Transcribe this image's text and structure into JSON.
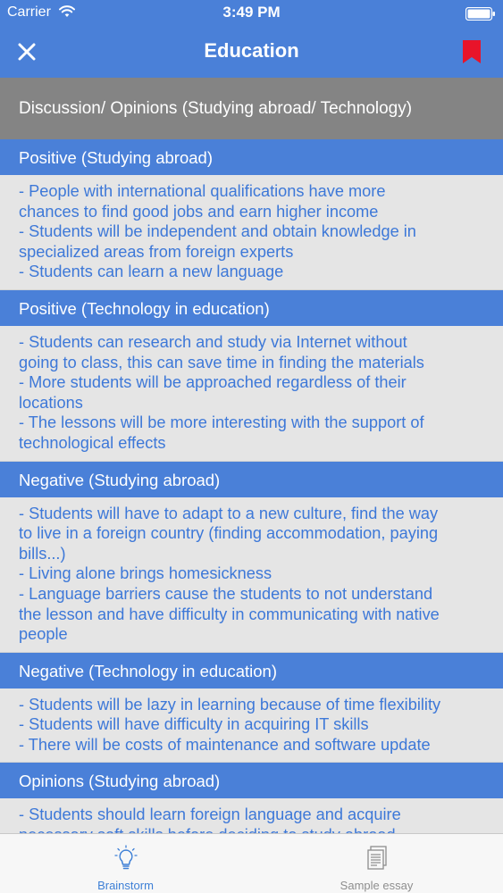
{
  "status_bar": {
    "carrier": "Carrier",
    "time": "3:49 PM"
  },
  "nav": {
    "title": "Education",
    "close_icon": "close-icon",
    "bookmark_icon": "bookmark-icon"
  },
  "topic": "Discussion/ Opinions (Studying abroad/ Technology)",
  "sections": [
    {
      "title": "Positive (Studying abroad)",
      "lines": [
        "- People with international qualifications have more",
        "chances to find good jobs and earn higher income",
        "- Students will be independent and obtain knowledge in",
        "specialized areas from foreign experts",
        "- Students can learn a new language"
      ]
    },
    {
      "title": "Positive (Technology in education)",
      "lines": [
        "- Students can research and study via Internet without",
        "going to class, this can save time in finding the materials",
        "- More students will be approached regardless of their",
        "locations",
        "- The lessons will be more interesting with the support of",
        "technological effects"
      ]
    },
    {
      "title": "Negative (Studying abroad)",
      "lines": [
        "- Students will have to adapt to a new culture, find the way",
        "to live in a foreign country (finding accommodation, paying",
        "bills...)",
        "- Living alone brings homesickness",
        "- Language barriers cause the students to not understand",
        "the lesson and have difficulty in communicating with native",
        "people"
      ]
    },
    {
      "title": "Negative (Technology in education)",
      "lines": [
        "- Students will be lazy in learning because of time flexibility",
        "- Students will have difficulty in acquiring IT skills",
        "- There will be costs of maintenance and software update"
      ]
    },
    {
      "title": "Opinions (Studying abroad)",
      "lines": [
        "- Students should learn foreign language and acquire",
        "necessary soft skills before deciding to study abroad"
      ]
    }
  ],
  "tabs": [
    {
      "label": "Brainstorm",
      "icon": "lightbulb-icon",
      "active": true
    },
    {
      "label": "Sample essay",
      "icon": "document-stack-icon",
      "active": false
    }
  ],
  "colors": {
    "primary": "#4a80d8",
    "topic_bg": "#848484",
    "body_text": "#3d78d8",
    "body_bg": "#e5e5e5",
    "bookmark": "#e8142a",
    "tab_active": "#3d7fd6",
    "tab_inactive": "#8e8e8e"
  }
}
